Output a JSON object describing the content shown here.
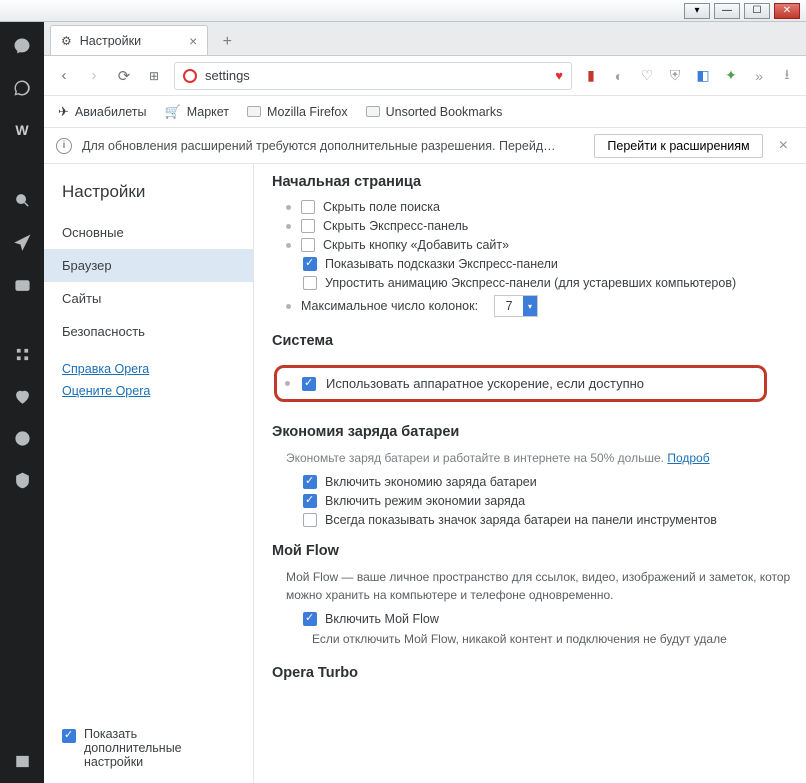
{
  "tab": {
    "title": "Настройки"
  },
  "address": {
    "text": "settings"
  },
  "bookmarks": {
    "aviabilets": "Авиабилеты",
    "market": "Маркет",
    "mozilla": "Mozilla Firefox",
    "unsorted": "Unsorted Bookmarks"
  },
  "notif": {
    "text": "Для обновления расширений требуются дополнительные разрешения. Перейд…",
    "button": "Перейти к расширениям"
  },
  "sidebar": {
    "title": "Настройки",
    "items": [
      "Основные",
      "Браузер",
      "Сайты",
      "Безопасность"
    ],
    "help": "Справка Opera",
    "rate": "Оцените Opera",
    "advanced": "Показать дополнительные настройки"
  },
  "sections": {
    "startpage": {
      "title": "Начальная страница",
      "opts": [
        "Скрыть поле поиска",
        "Скрыть Экспресс-панель",
        "Скрыть кнопку «Добавить сайт»",
        "Показывать подсказки Экспресс-панели",
        "Упростить анимацию Экспресс-панели (для устаревших компьютеров)"
      ],
      "maxcol_label": "Максимальное число колонок:",
      "maxcol_value": "7"
    },
    "system": {
      "title": "Система",
      "hwaccel": "Использовать аппаратное ускорение, если доступно"
    },
    "battery": {
      "title": "Экономия заряда батареи",
      "desc": "Экономьте заряд батареи и работайте в интернете на 50% дольше. ",
      "more": "Подроб",
      "opts": [
        "Включить экономию заряда батареи",
        "Включить режим экономии заряда",
        "Всегда показывать значок заряда батареи на панели инструментов"
      ]
    },
    "flow": {
      "title": "Мой Flow",
      "desc": "Мой Flow — ваше личное пространство для ссылок, видео, изображений и заметок, котор можно хранить на компьютере и телефоне одновременно.",
      "enable": "Включить Мой Flow",
      "note": "Если отключить Мой Flow, никакой контент и подключения не будут удале"
    },
    "turbo": {
      "title": "Opera Turbo"
    }
  }
}
